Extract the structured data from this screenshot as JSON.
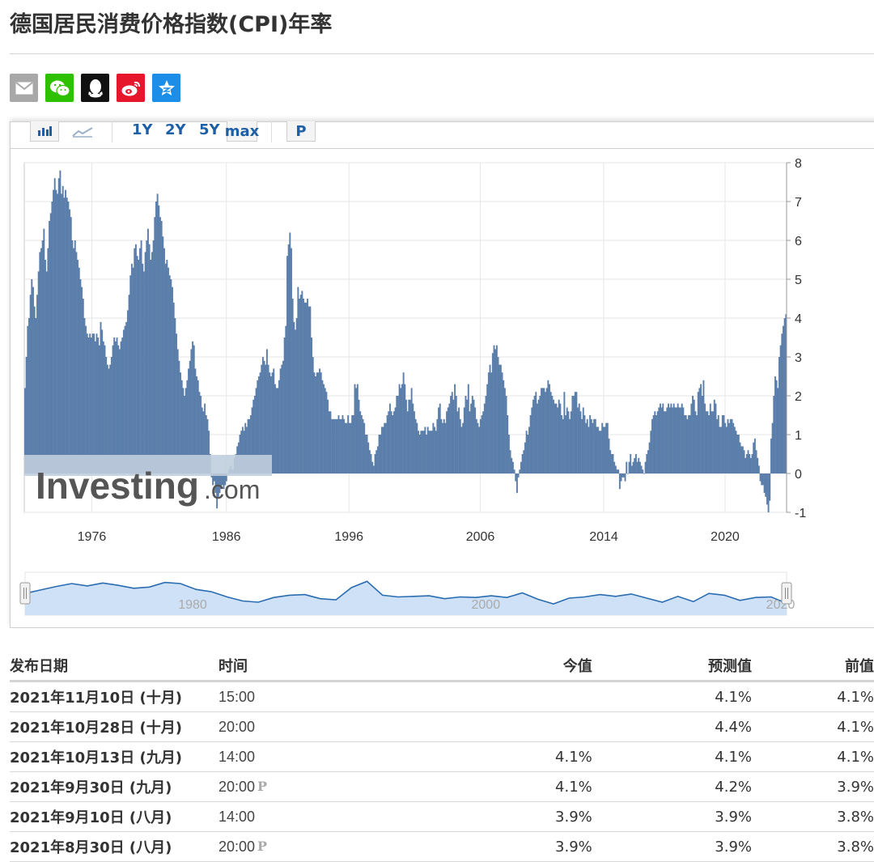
{
  "page": {
    "title": "德国居民消费价格指数(CPI)年率"
  },
  "share_icons": [
    {
      "name": "email-icon",
      "color": "#a8a8a8"
    },
    {
      "name": "wechat-icon",
      "color": "#2dc100"
    },
    {
      "name": "qq-icon",
      "color": "#111111"
    },
    {
      "name": "weibo-icon",
      "color": "#e6162d"
    },
    {
      "name": "qzone-icon",
      "color": "#1c8ee7"
    }
  ],
  "toolbar": {
    "chart_type_icons": [
      "bar-chart-icon",
      "line-chart-icon"
    ],
    "ranges": [
      "1Y",
      "2Y",
      "5Y",
      "max"
    ],
    "active_range": "max",
    "p_label": "P"
  },
  "chart_data": {
    "type": "bar",
    "x_ticks": [
      "1976",
      "1986",
      "1996",
      "2006",
      "2014",
      "2020"
    ],
    "y_ticks": [
      "8",
      "7",
      "6",
      "5",
      "4",
      "3",
      "2",
      "1",
      "0",
      "-1"
    ],
    "ylim": [
      -1,
      8
    ],
    "grid": true,
    "bar_color": "#5b7faa",
    "watermark": "Investing.com",
    "series": [
      {
        "year": 1972,
        "values": [
          2.2,
          3.0,
          3.8,
          4.0,
          4.6,
          5.0,
          4.8,
          4.3,
          4.0,
          4.6,
          5.2,
          5.7
        ]
      },
      {
        "year": 1973,
        "values": [
          5.8,
          6.0,
          6.3,
          5.5,
          5.2,
          5.8,
          6.5,
          6.7,
          7.0,
          7.3,
          7.6,
          7.3
        ]
      },
      {
        "year": 1974,
        "values": [
          7.2,
          7.6,
          7.8,
          7.2,
          7.4,
          7.1,
          7.3,
          7.1,
          7.0,
          6.8,
          6.6,
          6.0
        ]
      },
      {
        "year": 1975,
        "values": [
          5.8,
          6.0,
          5.7,
          5.5,
          5.3,
          5.0,
          4.8,
          4.5,
          4.0,
          3.8,
          3.6,
          3.5
        ]
      },
      {
        "year": 1976,
        "values": [
          3.6,
          3.5,
          3.6,
          3.6,
          3.4,
          3.6,
          3.5,
          3.3,
          3.9,
          3.7,
          3.4,
          3.3
        ]
      },
      {
        "year": 1977,
        "values": [
          3.0,
          2.8,
          2.7,
          2.8,
          3.0,
          3.3,
          3.5,
          3.4,
          3.5,
          3.3,
          3.2,
          3.4
        ]
      },
      {
        "year": 1978,
        "values": [
          3.5,
          3.7,
          3.8,
          3.9,
          4.2,
          4.6,
          5.1,
          5.4,
          5.3,
          5.8,
          5.9,
          5.6
        ]
      },
      {
        "year": 1979,
        "values": [
          5.5,
          5.8,
          6.0,
          5.4,
          5.2,
          5.7,
          6.0,
          6.3,
          5.9,
          5.5,
          5.7,
          6.0
        ]
      },
      {
        "year": 1980,
        "values": [
          6.6,
          7.0,
          7.2,
          6.9,
          6.6,
          6.5,
          6.1,
          5.8,
          5.4,
          5.5,
          5.3,
          5.1
        ]
      },
      {
        "year": 1981,
        "values": [
          5.0,
          4.8,
          4.4,
          4.0,
          3.6,
          3.2,
          2.9,
          2.6,
          2.4,
          2.2,
          2.0,
          2.2
        ]
      },
      {
        "year": 1982,
        "values": [
          2.4,
          2.7,
          2.9,
          3.2,
          3.4,
          3.3,
          2.7,
          2.5,
          2.4,
          2.1,
          2.0,
          1.7
        ]
      },
      {
        "year": 1983,
        "values": [
          1.6,
          1.8,
          1.5,
          1.4,
          1.1,
          0.5,
          -0.1,
          -0.3,
          -0.2,
          -0.5,
          -0.9,
          -0.6
        ]
      },
      {
        "year": 1984,
        "values": [
          -0.5,
          -0.4,
          -0.3,
          -0.4,
          -0.3,
          -0.2,
          0.0,
          0.1,
          0.2,
          0.1,
          0.1,
          0.4
        ]
      },
      {
        "year": 1985,
        "values": [
          0.5,
          0.7,
          0.8,
          1.0,
          1.1,
          1.2,
          1.1,
          1.3,
          1.2,
          1.4,
          1.4,
          1.5
        ]
      },
      {
        "year": 1986,
        "values": [
          1.7,
          1.9,
          2.0,
          2.2,
          2.4,
          2.5,
          2.6,
          2.8,
          3.0,
          2.9,
          2.8,
          3.2
        ]
      },
      {
        "year": 1987,
        "values": [
          2.8,
          2.6,
          2.5,
          2.6,
          2.7,
          2.3,
          2.2,
          2.2,
          2.4,
          2.7,
          2.8,
          2.9
        ]
      },
      {
        "year": 1988,
        "values": [
          3.5,
          3.8,
          5.6,
          5.9,
          6.2,
          5.8,
          4.5,
          3.9,
          3.7,
          4.0,
          4.8,
          4.5
        ]
      },
      {
        "year": 1989,
        "values": [
          4.6,
          4.7,
          4.5,
          4.4,
          4.4,
          4.5,
          4.3,
          4.3,
          3.5,
          3.0,
          2.6,
          2.5
        ]
      },
      {
        "year": 1990,
        "values": [
          2.6,
          2.6,
          2.7,
          2.6,
          2.4,
          2.3,
          2.2,
          2.1,
          1.9,
          1.6,
          1.6,
          1.4
        ]
      },
      {
        "year": 1991,
        "values": [
          1.4,
          1.4,
          1.4,
          1.4,
          1.5,
          1.4,
          1.4,
          1.5,
          1.4,
          1.3,
          1.3,
          1.5
        ]
      },
      {
        "year": 1992,
        "values": [
          1.3,
          1.3,
          1.5,
          1.5,
          2.3,
          2.2,
          2.3,
          1.9,
          1.6,
          1.5,
          1.4,
          1.3
        ]
      },
      {
        "year": 1993,
        "values": [
          1.0,
          1.0,
          0.8,
          0.6,
          0.5,
          0.3,
          0.2,
          0.5,
          0.6,
          0.7,
          1.0,
          1.0
        ]
      },
      {
        "year": 1994,
        "values": [
          1.2,
          1.2,
          1.3,
          1.3,
          1.5,
          1.6,
          1.8,
          1.6,
          1.5,
          1.6,
          1.7,
          2.0
        ]
      },
      {
        "year": 1995,
        "values": [
          2.0,
          2.3,
          2.2,
          2.3,
          2.6,
          2.3,
          1.9,
          1.6,
          1.9,
          1.9,
          2.2,
          1.8
        ]
      },
      {
        "year": 1996,
        "values": [
          1.6,
          1.4,
          1.3,
          1.1,
          1.0,
          1.1,
          1.1,
          1.1,
          1.2,
          1.0,
          1.2,
          1.1
        ]
      },
      {
        "year": 1997,
        "values": [
          1.1,
          1.1,
          1.3,
          1.2,
          1.1,
          1.4,
          1.7,
          1.8,
          1.4,
          1.3,
          1.4,
          1.3
        ]
      },
      {
        "year": 1998,
        "values": [
          1.6,
          1.7,
          1.8,
          2.0,
          2.1,
          1.9,
          2.3,
          2.0,
          1.6,
          1.7,
          1.4,
          1.2
        ]
      },
      {
        "year": 1999,
        "values": [
          1.3,
          1.7,
          2.0,
          1.9,
          2.3,
          1.6,
          1.8,
          2.0,
          1.9,
          1.7,
          1.4,
          1.3
        ]
      },
      {
        "year": 2000,
        "values": [
          1.2,
          1.4,
          1.5,
          1.6,
          1.8,
          2.0,
          2.3,
          2.6,
          2.8,
          2.6,
          3.1,
          3.3
        ]
      },
      {
        "year": 2001,
        "values": [
          3.2,
          3.3,
          3.0,
          2.8,
          2.8,
          2.6,
          2.4,
          2.2,
          2.0,
          1.5,
          1.0,
          0.6
        ]
      },
      {
        "year": 2002,
        "values": [
          0.4,
          0.3,
          0.1,
          -0.2,
          -0.5,
          -0.1,
          0.1,
          0.3,
          0.5,
          0.6,
          0.8,
          1.1
        ]
      },
      {
        "year": 2003,
        "values": [
          1.0,
          1.2,
          1.5,
          1.7,
          1.9,
          2.0,
          2.1,
          1.8,
          1.9,
          2.0,
          2.2,
          2.2
        ]
      },
      {
        "year": 2004,
        "values": [
          2.2,
          2.1,
          2.2,
          2.4,
          2.3,
          2.1,
          2.0,
          1.9,
          1.8,
          1.8,
          1.7,
          1.9
        ]
      },
      {
        "year": 2005,
        "values": [
          1.8,
          1.5,
          1.4,
          2.1,
          1.5,
          1.7,
          1.6,
          1.4,
          1.6,
          2.0,
          2.0,
          2.1
        ]
      },
      {
        "year": 2006,
        "values": [
          2.1,
          1.7,
          1.8,
          1.6,
          1.4,
          1.7,
          1.5,
          1.3,
          1.4,
          1.2,
          1.5,
          1.4
        ]
      },
      {
        "year": 2007,
        "values": [
          1.3,
          1.4,
          1.4,
          1.2,
          1.2,
          1.1,
          1.1,
          1.3,
          1.2,
          1.2,
          1.3,
          1.3
        ]
      },
      {
        "year": 2008,
        "values": [
          0.9,
          0.6,
          0.5,
          0.5,
          0.3,
          0.2,
          0.1,
          0.1,
          -0.4,
          -0.2,
          -0.1,
          -0.1
        ]
      },
      {
        "year": 2009,
        "values": [
          -0.2,
          0.3,
          0.0,
          0.3,
          0.5,
          0.2,
          0.3,
          0.4,
          0.5,
          0.3,
          0.4,
          0.3
        ]
      },
      {
        "year": 2010,
        "values": [
          0.2,
          0.1,
          0.0,
          0.3,
          0.5,
          0.6,
          0.8,
          1.1,
          1.4,
          1.5,
          1.6,
          1.5
        ]
      },
      {
        "year": 2011,
        "values": [
          1.6,
          1.7,
          1.8,
          1.7,
          1.8,
          1.6,
          1.6,
          1.7,
          1.8,
          1.7,
          1.8,
          1.7
        ]
      },
      {
        "year": 2012,
        "values": [
          1.8,
          1.7,
          1.7,
          1.8,
          1.7,
          1.7,
          1.8,
          1.7,
          1.5,
          1.5,
          1.4,
          1.5
        ]
      },
      {
        "year": 2013,
        "values": [
          1.5,
          1.8,
          2.0,
          1.9,
          1.6,
          1.5,
          2.1,
          2.2,
          2.3,
          2.0,
          2.4,
          1.8
        ]
      },
      {
        "year": 2014,
        "values": [
          1.6,
          1.6,
          1.5,
          1.8,
          1.6,
          1.6,
          1.9,
          1.8,
          1.4,
          1.5,
          1.2,
          1.2
        ]
      },
      {
        "year": 2015,
        "values": [
          1.5,
          1.5,
          1.3,
          1.2,
          1.4,
          1.3,
          1.4,
          1.4,
          1.3,
          1.2,
          1.1,
          1.0
        ]
      },
      {
        "year": 2016,
        "values": [
          1.0,
          0.8,
          0.7,
          0.7,
          0.6,
          0.4,
          0.5,
          0.6,
          0.5,
          0.4,
          0.5,
          0.8
        ]
      },
      {
        "year": 2017,
        "values": [
          0.9,
          0.6,
          0.4,
          0.2,
          -0.2,
          -0.3,
          -0.3,
          -0.5,
          -0.6,
          -0.8,
          -1.0,
          -0.7
        ]
      },
      {
        "year": 2018,
        "values": [
          0.9,
          1.3,
          2.0,
          2.5,
          2.4,
          2.2,
          3.0,
          3.3,
          3.6,
          3.8,
          4.0,
          4.1
        ]
      }
    ],
    "navigator": {
      "labels": [
        "1980",
        "2000",
        "2020"
      ],
      "points": [
        1.9,
        2.5,
        3.1,
        3.6,
        3.2,
        3.7,
        3.3,
        2.8,
        3.0,
        3.8,
        3.6,
        2.6,
        2.2,
        1.3,
        0.6,
        0.4,
        1.2,
        1.6,
        1.7,
        1.0,
        0.8,
        2.9,
        4.0,
        1.6,
        1.3,
        1.4,
        1.5,
        1.0,
        1.3,
        1.2,
        1.5,
        1.2,
        2.0,
        0.9,
        0.1,
        1.1,
        1.3,
        1.7,
        1.4,
        1.8,
        1.1,
        0.4,
        1.4,
        0.5,
        1.9,
        1.6,
        0.7,
        1.2,
        1.3,
        0.2
      ]
    }
  },
  "table": {
    "headers": [
      "发布日期",
      "时间",
      "今值",
      "预测值",
      "前值"
    ],
    "rows": [
      {
        "date": "2021年11月10日 (十月)",
        "time": "15:00",
        "p": "",
        "actual": "",
        "actual_class": "",
        "forecast": "4.1%",
        "previous": "4.1%",
        "previous_class": ""
      },
      {
        "date": "2021年10月28日 (十月)",
        "time": "20:00",
        "p": "",
        "actual": "",
        "actual_class": "",
        "forecast": "4.4%",
        "previous": "4.1%",
        "previous_class": "c-neg"
      },
      {
        "date": "2021年10月13日 (九月)",
        "time": "14:00",
        "p": "",
        "actual": "4.1%",
        "actual_class": "",
        "forecast": "4.1%",
        "previous": "4.1%",
        "previous_class": ""
      },
      {
        "date": "2021年9月30日 (九月)",
        "time": "20:00",
        "p": "P",
        "actual": "4.1%",
        "actual_class": "c-pos",
        "forecast": "4.2%",
        "previous": "3.9%",
        "previous_class": ""
      },
      {
        "date": "2021年9月10日 (八月)",
        "time": "14:00",
        "p": "",
        "actual": "3.9%",
        "actual_class": "",
        "forecast": "3.9%",
        "previous": "3.8%",
        "previous_class": ""
      },
      {
        "date": "2021年8月30日 (八月)",
        "time": "20:00",
        "p": "P",
        "actual": "3.9%",
        "actual_class": "",
        "forecast": "3.9%",
        "previous": "3.8%",
        "previous_class": ""
      }
    ]
  }
}
